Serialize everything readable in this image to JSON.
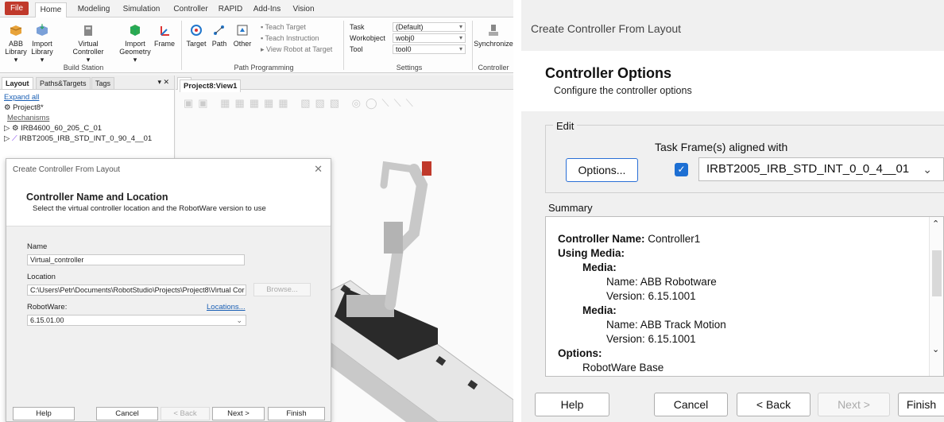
{
  "ribbon": {
    "tabs": [
      "File",
      "Home",
      "Modeling",
      "Simulation",
      "Controller",
      "RAPID",
      "Add-Ins",
      "Vision"
    ],
    "buttons": [
      {
        "label": "ABB\nLibrary ▾"
      },
      {
        "label": "Import\nLibrary ▾"
      },
      {
        "label": "Virtual\nController ▾"
      },
      {
        "label": "Import\nGeometry ▾"
      },
      {
        "label": "Frame"
      },
      {
        "label": "Target"
      },
      {
        "label": "Path"
      },
      {
        "label": "Other"
      },
      {
        "label": "Synchronize"
      }
    ],
    "small_items": [
      "Teach Target",
      "Teach Instruction",
      "View Robot at Target"
    ],
    "groups": [
      "Build Station",
      "Path Programming",
      "Settings",
      "Controller"
    ],
    "settings": {
      "task_label": "Task",
      "task_value": "(Default)",
      "workobject_label": "Workobject",
      "workobject_value": "wobj0",
      "tool_label": "Tool",
      "tool_value": "tool0"
    }
  },
  "layout_panel": {
    "tabs": [
      "Layout",
      "Paths&Targets",
      "Tags"
    ],
    "expand_all": "Expand all",
    "project": "Project8*",
    "mechanisms": "Mechanisms",
    "items": [
      "IRB4600_60_205_C_01",
      "IRBT2005_IRB_STD_INT_0_90_4__01"
    ]
  },
  "view_tab": "Project8:View1",
  "small_dialog": {
    "title": "Create Controller From Layout",
    "heading": "Controller Name and Location",
    "subheading": "Select the virtual controller location and the RobotWare version to use",
    "name_label": "Name",
    "name_value": "Virtual_controller",
    "location_label": "Location",
    "location_value": "C:\\Users\\Petr\\Documents\\RobotStudio\\Projects\\Project8\\Virtual Cor",
    "browse": "Browse...",
    "robotware_label": "RobotWare:",
    "locations_link": "Locations...",
    "robotware_value": "6.15.01.00",
    "buttons": {
      "help": "Help",
      "cancel": "Cancel",
      "back": "< Back",
      "next": "Next >",
      "finish": "Finish"
    }
  },
  "big_dialog": {
    "title": "Create Controller From Layout",
    "heading": "Controller Options",
    "subheading": "Configure the controller options",
    "edit_label": "Edit",
    "options_button": "Options...",
    "taskframe_label": "Task Frame(s) aligned with",
    "taskframe_checked": true,
    "taskframe_value": "IRBT2005_IRB_STD_INT_0_0_4__01",
    "summary_label": "Summary",
    "summary": {
      "controller_name_key": "Controller Name:",
      "controller_name_val": " Controller1",
      "using_media": "Using Media:",
      "media1": "Media:",
      "media1_name": "Name: ABB Robotware",
      "media1_version": "Version: 6.15.1001",
      "media2": "Media:",
      "media2_name": "Name: ABB Track Motion",
      "media2_version": "Version: 6.15.1001",
      "options": "Options:",
      "robotware_base": "RobotWare Base"
    },
    "buttons": {
      "help": "Help",
      "cancel": "Cancel",
      "back": "< Back",
      "next": "Next >",
      "finish": "Finish"
    }
  }
}
